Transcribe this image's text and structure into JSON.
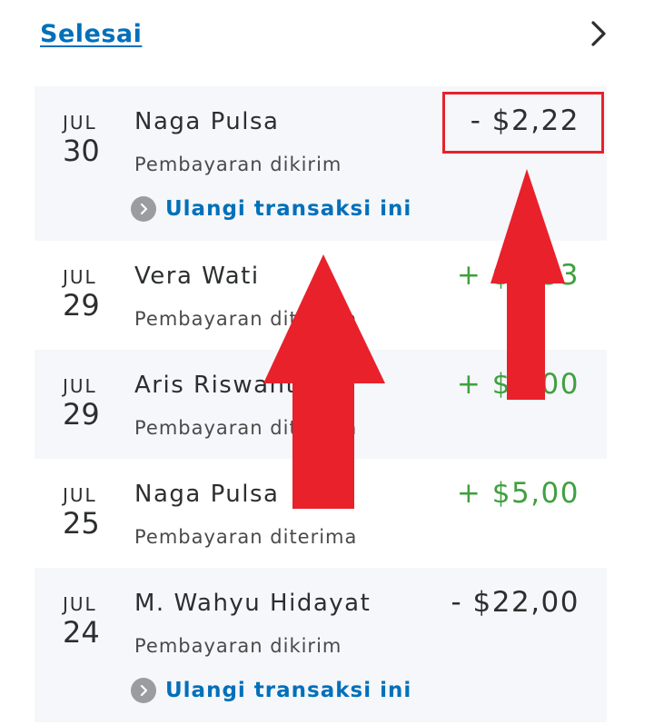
{
  "header": {
    "done_label": "Selesai",
    "chevron_icon": "chevron-right-icon"
  },
  "transactions": [
    {
      "month": "JUL",
      "day": "30",
      "name": "Naga Pulsa",
      "status": "Pembayaran dikirim",
      "amount": "- $2,22",
      "direction": "out",
      "repeat_label": "Ulangi transaksi ini",
      "highlighted": true
    },
    {
      "month": "JUL",
      "day": "29",
      "name": "Vera Wati",
      "status": "Pembayaran diterima",
      "amount": "+ $3,33",
      "direction": "in"
    },
    {
      "month": "JUL",
      "day": "29",
      "name": "Aris Riswanto",
      "status": "Pembayaran diterima",
      "amount": "+ $5,00",
      "direction": "in"
    },
    {
      "month": "JUL",
      "day": "25",
      "name": "Naga Pulsa",
      "status": "Pembayaran diterima",
      "amount": "+ $5,00",
      "direction": "in"
    },
    {
      "month": "JUL",
      "day": "24",
      "name": "M. Wahyu Hidayat",
      "status": "Pembayaran dikirim",
      "amount": "- $22,00",
      "direction": "out",
      "repeat_label": "Ulangi transaksi ini"
    }
  ],
  "annotations": {
    "arrow_color": "#e8212b",
    "highlight_color": "#e8212b",
    "icons": [
      "arrow-up-icon",
      "arrow-up-icon"
    ]
  },
  "colors": {
    "link_blue": "#0070ba",
    "positive_green": "#40a040",
    "row_shade": "#f5f7fa"
  }
}
